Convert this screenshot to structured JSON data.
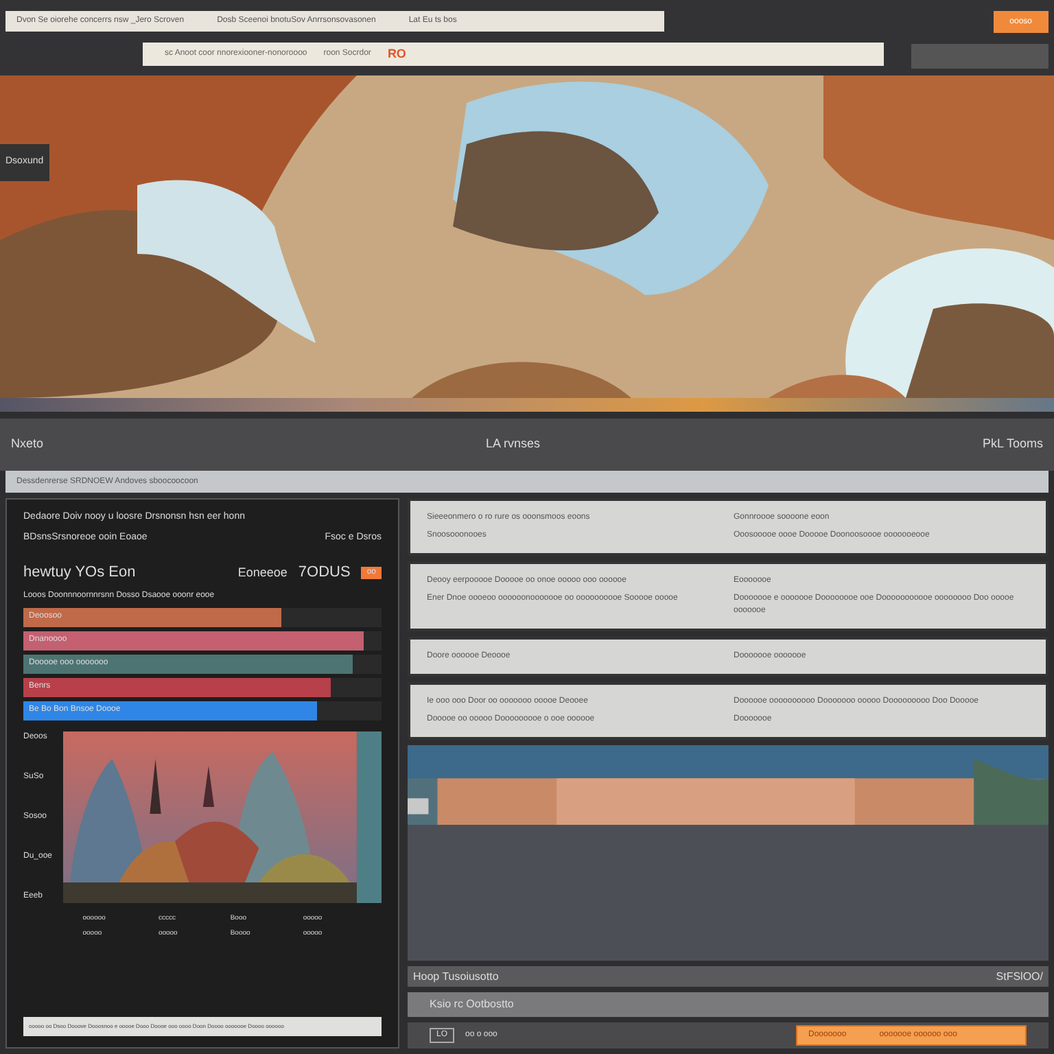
{
  "top_bar": {
    "address": "Dvon Se oiorehe concerrs nsw _Jero Scroven",
    "address_middle": "Dosb Sceenoi bnotuSov Anrrsonsovasonen",
    "address_right": "Lat Eu ts bos",
    "search": "sc Anoot coor nnorexiooner-nonoroooo",
    "search_hint": "roon Socrdor",
    "badge": "RO",
    "action": "oooso"
  },
  "hero": {
    "label": "Dsoxund"
  },
  "section_bar": {
    "left": "Nxeto",
    "center": "LA rvnses",
    "right": "PkL Tooms"
  },
  "filter": {
    "value": "Dessdenrerse SRDNOEW Andoves sboocoocoon"
  },
  "left_panel": {
    "heading": "Dedaore Doiv nooy u loosre Drsnonsn hsn eer honn",
    "subheading": "BDsnsSrsnoreoe ooin Eoaoe",
    "subheading_right": "Fsoc e Dsros",
    "title": "hewtuy YOs Eon",
    "title_right": "Eoneeoe",
    "value": "7ODUS",
    "value_badge": "oo",
    "caption": "Looos Doonnnoornnrsnn Dosso Dsaooe ooonr eooe",
    "bars": [
      {
        "label": "Deoosoo",
        "color": "#c06a4a",
        "level": 0.72
      },
      {
        "label": "Dnanoooo",
        "color": "#c46070",
        "level": 0.95
      },
      {
        "label": "Dooooe ooo ooooooo",
        "color": "#4d7472",
        "level": 0.92
      },
      {
        "label": "Benrs",
        "color": "#b8404a",
        "level": 0.86
      },
      {
        "label": "Be Bo Bon Bnsoe Doooe",
        "color": "#2f86e6",
        "level": 0.82
      }
    ],
    "axis": [
      "Deoos",
      "SuSo",
      "Sosoo",
      "Du_ooe",
      "Eeeb"
    ],
    "columns": [
      [
        "oooooo",
        "ooooo"
      ],
      [
        "ccccc",
        "ooooo"
      ],
      [
        "Booo",
        "Boooo"
      ],
      [
        "ooooo",
        "ooooo"
      ]
    ],
    "footer": "ooooo oo Dsoo Dooove Dooosnoo e ooooe Dooo Doooe ooo oooo Doon Doooo ooooooe Doooo oooooo"
  },
  "cards": [
    {
      "left_title": "Sieeeonmero o ro rure os ooonsmoos eoons",
      "left_text": "Snoosooonooes",
      "right_title": "Gonnroooe soooone eoon",
      "right_text": "Ooosooooe oooe Dooooe Doonoosoooe ooooooeooe"
    },
    {
      "left_title": "Deooy eerpooooe Dooooe oo onoe ooooo ooo oooooe",
      "left_text": "Ener Dnoe oooeoo oooooonooooooe oo oooooooooe Sooooe ooooe",
      "right_title": "Eooooooe",
      "right_text": "Dooooooe e ooooooe Doooooooe ooe Dooooooooooe oooooooo Doo ooooe ooooooe"
    },
    {
      "left_title": "Doore oooooe Deoooe",
      "right_title": "Dooooooe ooooooe"
    },
    {
      "left_title": "Ie ooo ooo Door oo ooooooo ooooe Deooee",
      "left_text": "Dooooe oo ooooo Dooooooooe o ooe oooooe",
      "right_title": "Doooooe oooooooooo Dooooooo ooooo Dooooooooo Doo Dooooe",
      "right_text": "Dooooooe"
    }
  ],
  "player": {
    "heading": "Hoop Tusoiusotto",
    "heading_right": "StFSlOO/",
    "subheading": "Ksio rc Ootbostto",
    "tag": "LO",
    "time": "oo o ooo",
    "progress_label": "Dooooooo",
    "progress_text": "ooooooe oooooo ooo",
    "level": 1
  }
}
